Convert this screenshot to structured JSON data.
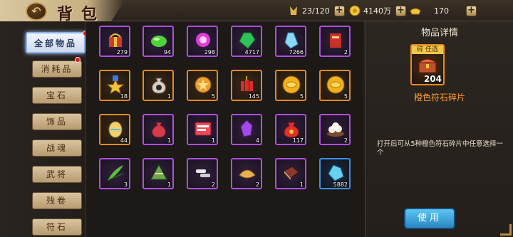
{
  "header": {
    "title": "背包",
    "back_icon": "back-arrow-icon"
  },
  "resources": {
    "bag_capacity": "23/120",
    "gold": "4140万",
    "ingot": "170"
  },
  "nav": {
    "items": [
      {
        "label": "全部物品",
        "active": true,
        "badge": true
      },
      {
        "label": "消耗品",
        "active": false,
        "badge": true
      },
      {
        "label": "宝石",
        "active": false,
        "badge": false
      },
      {
        "label": "饰品",
        "active": false,
        "badge": false
      },
      {
        "label": "战魂",
        "active": false,
        "badge": false
      },
      {
        "label": "武将",
        "active": false,
        "badge": false
      },
      {
        "label": "残卷",
        "active": false,
        "badge": false
      },
      {
        "label": "符石",
        "active": false,
        "badge": false
      }
    ]
  },
  "grid": {
    "items": [
      {
        "icon": "red-gift-box-icon",
        "count": "279",
        "rarity": "purple"
      },
      {
        "icon": "green-orb-icon",
        "count": "94",
        "rarity": "purple"
      },
      {
        "icon": "pink-orb-icon",
        "count": "298",
        "rarity": "purple"
      },
      {
        "icon": "green-gem-icon",
        "count": "4717",
        "rarity": "purple"
      },
      {
        "icon": "blue-crystal-icon",
        "count": "7266",
        "rarity": "purple"
      },
      {
        "icon": "red-scroll-icon",
        "count": "2",
        "rarity": "purple"
      },
      {
        "icon": "star-medal-icon",
        "count": "18",
        "rarity": "orange"
      },
      {
        "icon": "coin-pouch-icon",
        "count": "1",
        "rarity": "orange"
      },
      {
        "icon": "star-coin-icon",
        "count": "5",
        "rarity": "orange"
      },
      {
        "icon": "firecracker-icon",
        "count": "145",
        "rarity": "orange"
      },
      {
        "icon": "gold-coin-icon",
        "count": "5",
        "rarity": "orange"
      },
      {
        "icon": "gold-coin-icon",
        "count": "5",
        "rarity": "orange"
      },
      {
        "icon": "golden-egg-icon",
        "count": "44",
        "rarity": "orange"
      },
      {
        "icon": "red-bag-icon",
        "count": "1",
        "rarity": "purple"
      },
      {
        "icon": "card-ticket-icon",
        "count": "1",
        "rarity": "purple"
      },
      {
        "icon": "purple-crystal-icon",
        "count": "4",
        "rarity": "purple"
      },
      {
        "icon": "lucky-bag-icon",
        "count": "117",
        "rarity": "purple"
      },
      {
        "icon": "rice-balls-icon",
        "count": "2",
        "rarity": "purple"
      },
      {
        "icon": "bamboo-leaf-icon",
        "count": "3",
        "rarity": "purple"
      },
      {
        "icon": "zongzi-icon",
        "count": "1",
        "rarity": "purple"
      },
      {
        "icon": "silver-bars-icon",
        "count": "2",
        "rarity": "purple"
      },
      {
        "icon": "dumpling-icon",
        "count": "2",
        "rarity": "purple"
      },
      {
        "icon": "book-icon",
        "count": "1",
        "rarity": "purple"
      },
      {
        "icon": "ice-crystal-icon",
        "count": "5882",
        "rarity": "blue"
      }
    ]
  },
  "detail": {
    "title": "物品详情",
    "item_tag": "碎 任选",
    "item_count": "204",
    "item_name": "橙色符石碎片",
    "description": "打开后可从5种橙色符石碎片中任意选择一个",
    "use_label": "使用"
  },
  "colors": {
    "orange": "#e88a1e",
    "purple": "#b04ee0",
    "blue": "#3e8fe8",
    "accent_name": "#ff9a2a"
  }
}
